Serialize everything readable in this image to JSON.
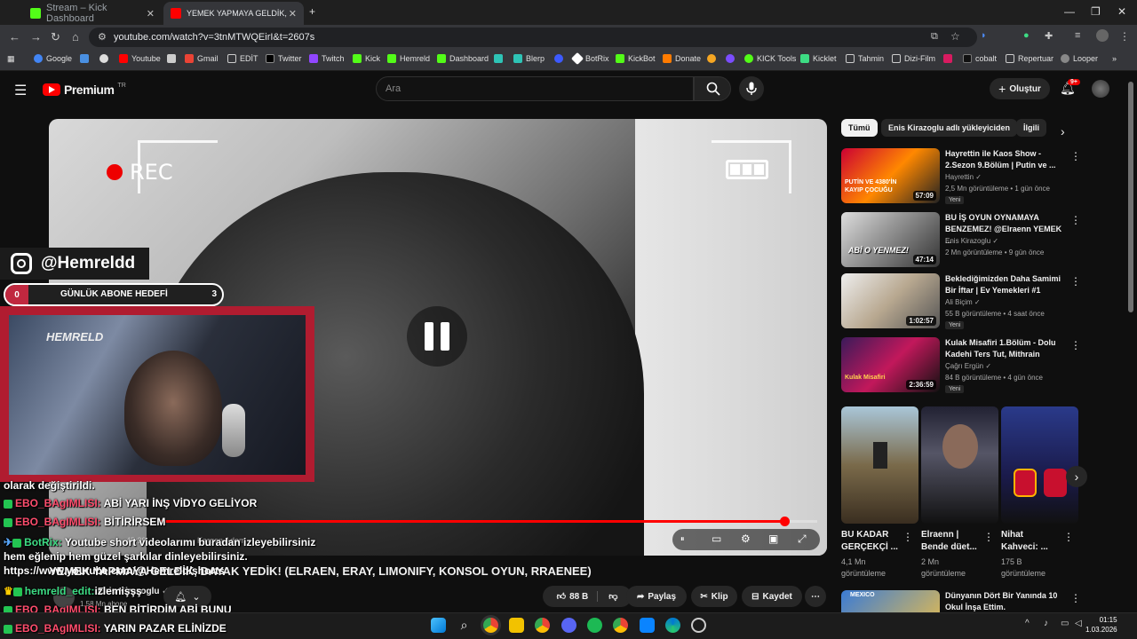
{
  "browser": {
    "tabs": [
      {
        "title": "Stream – Kick Dashboard",
        "active": false
      },
      {
        "title": "YEMEK YAPMAYA GELDİK, D",
        "active": true
      }
    ],
    "new_tab": "+",
    "url": "youtube.com/watch?v=3tnMTWQEirI&t=2607s",
    "bookmarks": [
      "Google",
      "Youtube",
      "Gmail",
      "EDİT",
      "Twitter",
      "Twitch",
      "Kick",
      "Hemreld",
      "Dashboard",
      "Blerp",
      "BotRix",
      "KickBot",
      "Donate",
      "KICK Tools",
      "Kicklet",
      "Tahmin",
      "Dizi-Film",
      "cobalt",
      "Repertuar",
      "Looper"
    ]
  },
  "youtube": {
    "logo": "Premium",
    "logo_sup": "TR",
    "search_placeholder": "Ara",
    "create_label": "Oluştur",
    "notif_count": "9+"
  },
  "player": {
    "rec_text": "REC",
    "progress_fraction": 0.95
  },
  "overlay": {
    "instagram_handle": "@Hemreldd",
    "goal_start": "0",
    "goal_label": "GÜNLÜK ABONE HEDEFİ",
    "goal_end": "3",
    "cam_logo": "HEMRELD"
  },
  "chat": [
    {
      "user": "",
      "text": "olarak değiştirildi."
    },
    {
      "user": "EBO_BAgIMLISI:",
      "text": "ABİ YARI İNŞ VİDYO GELİYOR"
    },
    {
      "user": "EBO_BAgIMLISI:",
      "text": "BİTİRİRSEM"
    },
    {
      "user": "BotRix:",
      "text": "Youtube short videolarımı buradan izleyebilirsiniz"
    },
    {
      "user": "",
      "text": "hem eğlenip hem güzel şarkılar dinleyebilirsiniz."
    },
    {
      "user": "",
      "text": "https://www.youtube.com/@Hemreld/shorts"
    },
    {
      "user": "hemreld_edit:",
      "text": "izlemişşş"
    },
    {
      "user": "EBO_BAgIMLISI:",
      "text": "BEN BİTİRDİM ABİ BUNU"
    },
    {
      "user": "EBO_BAgIMLISI:",
      "text": "YARIN PAZAR ELİNİZDE"
    }
  ],
  "video": {
    "title": "YEMEK YAPMAYA GELDİK, DAYAK YEDİK! (ELRAEN, ERAY, LIMONIFY, KONSOL OYUN, RRAENEE)",
    "channel": "Enis Kirazoglu",
    "subs": "1,58 Mn abone",
    "likes": "88 B",
    "share": "Paylaş",
    "clip": "Klip",
    "save": "Kaydet",
    "time_fragment": "45:39",
    "chapter_fragment": "Kargon Adam"
  },
  "sidebar": {
    "chips": [
      "Tümü",
      "Enis Kirazoglu adlı yükleyiciden",
      "İlgili"
    ],
    "items": [
      {
        "title": "Hayrettin ile Kaos Show - 2.Sezon 9.Bölüm | Putin ve ...",
        "channel": "Hayrettin",
        "meta": "2,5 Mn görüntüleme • 1 gün önce",
        "badge": "Yeni",
        "duration": "57:09",
        "thumb_text": "PUTİN VE 4380'İN KAYIP ÇOCUĞU"
      },
      {
        "title": "BU İŞ OYUN OYNAMAYA BENZEMEZ! @Elraenn YEMEK ...",
        "channel": "Enis Kirazoglu",
        "meta": "2 Mn görüntüleme • 9 gün önce",
        "badge": "",
        "duration": "47:14",
        "thumb_text": "ABİ O YENMEZ!"
      },
      {
        "title": "Beklediğimizden Daha Samimi Bir İftar | Ev Yemekleri #1",
        "channel": "Ali Biçim",
        "meta": "55 B görüntüleme • 4 saat önce",
        "badge": "Yeni",
        "duration": "1:02:57",
        "thumb_text": ""
      },
      {
        "title": "Kulak Misafiri 1.Bölüm - Dolu Kadehi Ters Tut, Mithrain",
        "channel": "Çağrı Ergün",
        "meta": "84 B görüntüleme • 4 gün önce",
        "badge": "Yeni",
        "duration": "2:36:59",
        "thumb_text": "Kulak Misafiri"
      }
    ],
    "shorts": [
      {
        "title": "BU KADAR GERÇEKÇİ ...",
        "views": "4,1 Mn görüntüleme"
      },
      {
        "title": "Elraenn | Bende düet...",
        "views": "2 Mn görüntüleme"
      },
      {
        "title": "Nihat Kahveci: ...",
        "views": "175 B görüntüleme"
      }
    ],
    "next_item": {
      "title": "Dünyanın Dört Bir Yanında 10 Okul İnşa Ettim.",
      "thumb_text": "MEXICO"
    }
  },
  "taskbar": {
    "time": "01:15",
    "date": "1.03.2026"
  },
  "colors": {
    "brand_red": "#ff0000",
    "chat_user": "#ff4d6d",
    "goal_red": "#c0283f"
  }
}
